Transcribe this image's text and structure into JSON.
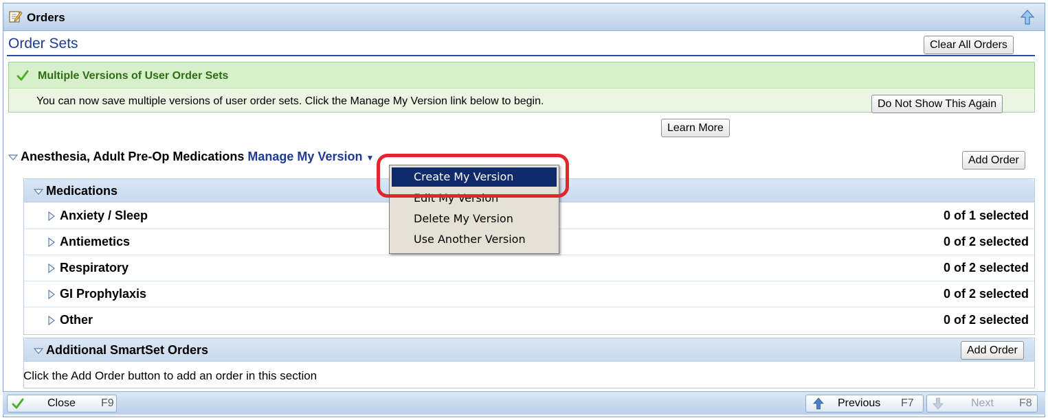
{
  "window": {
    "title": "Orders"
  },
  "toolbar": {
    "clear_all_label": "Clear All Orders"
  },
  "order_sets": {
    "title": "Order Sets"
  },
  "notice": {
    "title": "Multiple Versions of User Order Sets",
    "body": "You can now save multiple versions of user order sets. Click the Manage My Version link below to begin.",
    "learn_more_label": "Learn More",
    "dismiss_label": "Do Not Show This Again"
  },
  "order_set": {
    "name": "Anesthesia, Adult Pre-Op Medications",
    "manage_link": "Manage My Version",
    "add_order_label": "Add Order"
  },
  "medications": {
    "title": "Medications",
    "rows": [
      {
        "label": "Anxiety / Sleep",
        "count": "0 of 1 selected"
      },
      {
        "label": "Antiemetics",
        "count": "0 of 2 selected"
      },
      {
        "label": "Respiratory",
        "count": "0 of 2 selected"
      },
      {
        "label": "GI Prophylaxis",
        "count": "0 of 2 selected"
      },
      {
        "label": "Other",
        "count": "0 of 2 selected"
      }
    ]
  },
  "additional": {
    "title": "Additional SmartSet Orders",
    "add_order_label": "Add Order",
    "empty_message": "Click the Add Order button to add an order in this section"
  },
  "context_menu": {
    "items": [
      "Create My Version",
      "Edit My Version",
      "Delete My Version",
      "Use Another Version"
    ],
    "active_index": 0
  },
  "footer": {
    "close_label": "Close",
    "close_key": "F9",
    "previous_label": "Previous",
    "previous_key": "F7",
    "next_label": "Next",
    "next_key": "F8"
  },
  "colors": {
    "link_blue": "#1d3a96",
    "notice_green": "#2d6d16",
    "menu_highlight": "#0f2a6b",
    "annotation_red": "#e3262b"
  }
}
